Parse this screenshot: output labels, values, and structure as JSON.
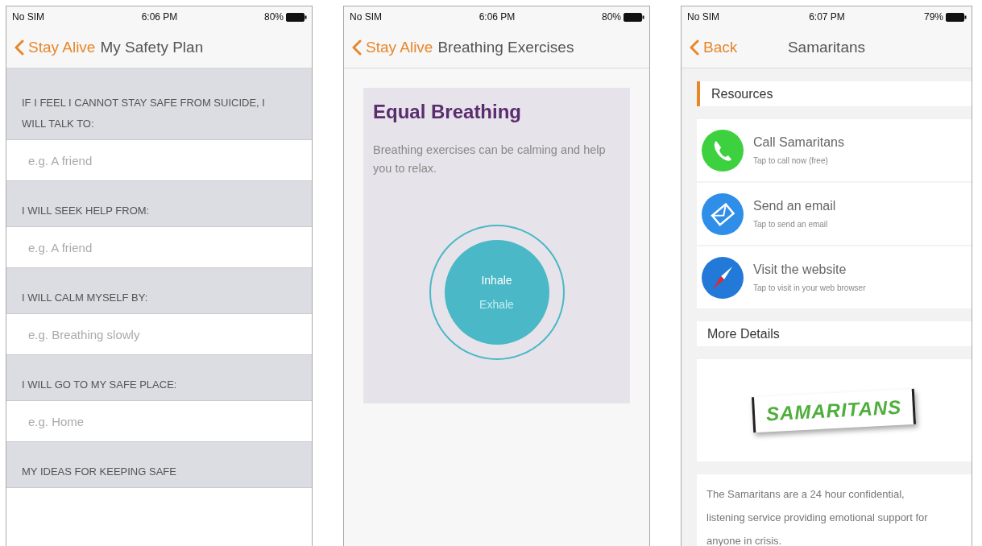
{
  "screens": [
    {
      "kind": "safety_plan",
      "status": {
        "carrier": "No SIM",
        "time": "6:06 PM",
        "battery": "80%"
      },
      "nav": {
        "back": "Stay Alive",
        "title": "My Safety Plan"
      },
      "sections": [
        {
          "heading": "IF I FEEL I CANNOT STAY SAFE FROM SUICIDE, I WILL TALK TO:",
          "placeholder": "e.g. A friend"
        },
        {
          "heading": "I WILL SEEK HELP FROM:",
          "placeholder": "e.g. A friend"
        },
        {
          "heading": "I WILL CALM MYSELF BY:",
          "placeholder": "e.g. Breathing slowly"
        },
        {
          "heading": "I WILL GO TO MY SAFE PLACE:",
          "placeholder": "e.g. Home"
        },
        {
          "heading": "MY IDEAS FOR KEEPING SAFE"
        }
      ]
    },
    {
      "kind": "breathing",
      "status": {
        "carrier": "No SIM",
        "time": "6:06 PM",
        "battery": "80%"
      },
      "nav": {
        "back": "Stay Alive",
        "title": "Breathing Exercises"
      },
      "card": {
        "title": "Equal Breathing",
        "description": "Breathing exercises can be calming and help you to relax.",
        "phases": [
          {
            "label": "Inhale",
            "selected": true
          },
          {
            "label": "Exhale",
            "selected": false
          }
        ]
      }
    },
    {
      "kind": "resource",
      "status": {
        "carrier": "No SIM",
        "time": "6:07 PM",
        "battery": "79%"
      },
      "nav": {
        "back": "Back",
        "title": "Samaritans"
      },
      "resources_heading": "Resources",
      "actions": [
        {
          "kind": "phone",
          "title": "Call Samaritans",
          "subtitle": "Tap to call now (free)"
        },
        {
          "kind": "email",
          "title": "Send an email",
          "subtitle": "Tap to send an email"
        },
        {
          "kind": "web",
          "title": "Visit the website",
          "subtitle": "Tap to visit in your web browser"
        }
      ],
      "details_heading": "More Details",
      "logo_text": "SAMARITANS",
      "description": "The Samaritans are a 24 hour confidential, listening service providing emotional support for anyone in crisis."
    }
  ]
}
